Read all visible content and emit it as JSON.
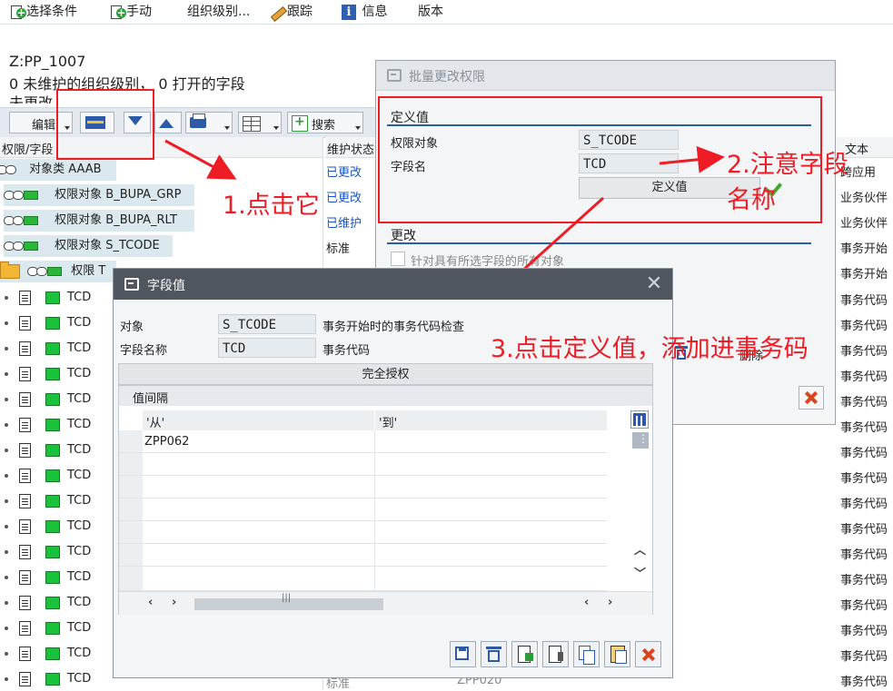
{
  "menu": {
    "items": [
      "选择条件",
      "手动",
      "组织级别...",
      "跟踪",
      "信息",
      "版本"
    ]
  },
  "header": {
    "line1": "Z:PP_1007",
    "line2": "0 未维护的组织级别， 0 打开的字段",
    "line3": "未更改"
  },
  "toolbar": {
    "edit_label": "编辑",
    "search_label": "搜索"
  },
  "columns": {
    "left": "权限/字段",
    "status": "维护状态",
    "right": "文本"
  },
  "tree": {
    "class_row": {
      "label": "对象类 AAAB"
    },
    "objects": [
      {
        "label": "权限对象 B_BUPA_GRP",
        "status": "已更改",
        "text": "业务伙伴"
      },
      {
        "label": "权限对象 B_BUPA_RLT",
        "status": "已维护",
        "text": "业务伙伴"
      },
      {
        "label": "权限对象 S_TCODE",
        "status": "标准",
        "text": "事务开始"
      }
    ],
    "class_status": "已更改",
    "class_text": "跨应用",
    "folder_row": {
      "label": "权限 T",
      "text": "事务开始"
    },
    "field_rows": [
      {
        "label": "TCD",
        "text": "事务代码"
      },
      {
        "label": "TCD",
        "text": "事务代码"
      },
      {
        "label": "TCD",
        "text": "事务代码"
      },
      {
        "label": "TCD",
        "text": "事务代码"
      },
      {
        "label": "TCD",
        "text": "事务代码"
      },
      {
        "label": "TCD",
        "text": "事务代码"
      },
      {
        "label": "TCD",
        "text": "事务代码"
      },
      {
        "label": "TCD",
        "text": "事务代码"
      },
      {
        "label": "TCD",
        "text": "事务代码"
      },
      {
        "label": "TCD",
        "text": "事务代码"
      },
      {
        "label": "TCD",
        "text": "事务代码"
      },
      {
        "label": "TCD",
        "text": "事务代码"
      },
      {
        "label": "TCD",
        "text": "事务代码"
      },
      {
        "label": "TCD",
        "text": "事务代码"
      },
      {
        "label": "TCD",
        "text": "事务代码"
      },
      {
        "label": "TCD",
        "text": "事务代码"
      }
    ],
    "last_status": "标准",
    "last_value": "ZPP020"
  },
  "dialog_mass": {
    "title": "批量更改权限",
    "group_define": "定义值",
    "field_object_label": "权限对象",
    "field_object_value": "S_TCODE",
    "field_name_label": "字段名",
    "field_name_value": "TCD",
    "define_button": "定义值",
    "group_change": "更改",
    "checkbox_label": "针对具有所选字段的所有对象",
    "delete_label": "删除"
  },
  "dialog_field": {
    "title": "字段值",
    "object_label": "对象",
    "object_value": "S_TCODE",
    "object_desc": "事务开始时的事务代码检查",
    "field_label": "字段名称",
    "field_value": "TCD",
    "field_desc": "事务代码",
    "full_auth": "完全授权",
    "interval_title": "值间隔",
    "col_from": "'从'",
    "col_to": "'到'",
    "rows": [
      {
        "from": "ZPP062",
        "to": ""
      },
      {
        "from": "",
        "to": ""
      },
      {
        "from": "",
        "to": ""
      },
      {
        "from": "",
        "to": ""
      },
      {
        "from": "",
        "to": ""
      },
      {
        "from": "",
        "to": ""
      },
      {
        "from": "",
        "to": ""
      }
    ]
  },
  "annotations": {
    "step1": "1.点击它",
    "step2a": "2.注意字段",
    "step2b": "名称",
    "step3": "3.点击定义值，添加进事务码"
  },
  "colors": {
    "annotation_red": "#ee1c25",
    "dialog_title_dark": "#4f565d",
    "status_blue": "#1a55c2",
    "highlight_row": "#dbe9ee"
  }
}
